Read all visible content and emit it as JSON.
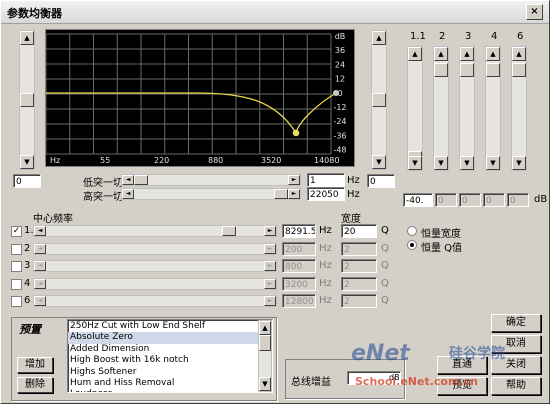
{
  "window": {
    "title": "参数均衡器",
    "close_label": "×"
  },
  "graph": {
    "db_ticks": [
      "dB",
      "36",
      "24",
      "12",
      "0",
      "-12",
      "-24",
      "-36",
      "-48"
    ],
    "freq_ticks": [
      "Hz",
      "55",
      "220",
      "880",
      "3520",
      "14080"
    ],
    "curve_color": "#e8d84a",
    "marker_color": "#e8d84a"
  },
  "bands_header": [
    "1",
    "2",
    "3",
    "4",
    "6"
  ],
  "bands_subheader": ".1",
  "gain_field": "-40.",
  "gain_unit": "dB",
  "left_value": "0",
  "right_value": "0",
  "lowcut": {
    "label": "低突一切",
    "value": "1",
    "unit": "Hz"
  },
  "highcut": {
    "label": "高突一切",
    "value": "22050",
    "unit": "Hz"
  },
  "center_freq_label": "中心频率",
  "width_label": "宽度",
  "rows": [
    {
      "label": "1.",
      "checked": "✓",
      "freq": "8291.5",
      "width": "20",
      "enabled": true
    },
    {
      "label": "2",
      "checked": "",
      "freq": "200",
      "width": "2",
      "enabled": false
    },
    {
      "label": "3",
      "checked": "",
      "freq": "800",
      "width": "2",
      "enabled": false
    },
    {
      "label": "4",
      "checked": "",
      "freq": "3200",
      "width": "2",
      "enabled": false
    },
    {
      "label": "6",
      "checked": "",
      "freq": "12800",
      "width": "2",
      "enabled": false
    }
  ],
  "hz_unit": "Hz",
  "q_unit": "Q",
  "radio": {
    "constant_width": "恒量宽度",
    "constant_q": "恒量 Q值"
  },
  "presets": {
    "title": "预置",
    "add": "增加",
    "delete": "删除",
    "items": [
      "250Hz Cut with Low End Shelf",
      "Absolute Zero",
      "Added Dimension",
      "High Boost with 16k notch",
      "Highs Softener",
      "Hum and Hiss Removal",
      "Loudness"
    ],
    "selected_index": 1
  },
  "master_gain": {
    "label": "总线增益",
    "unit": "dB"
  },
  "buttons": {
    "ok": "确定",
    "cancel": "取消",
    "bypass": "直通",
    "close": "关闭",
    "preview": "预览",
    "help": "帮助"
  },
  "watermark": {
    "top": "硅谷学院",
    "brand": "eNet",
    "url": "School.eNet.com.cn"
  }
}
